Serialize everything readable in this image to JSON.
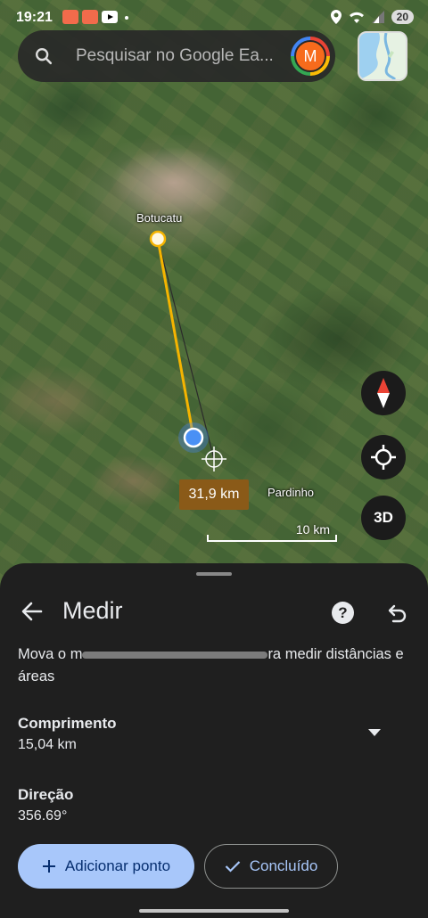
{
  "status": {
    "time": "19:21",
    "battery": "20"
  },
  "search": {
    "placeholder": "Pesquisar no Google Ea...",
    "avatar_letter": "M"
  },
  "map": {
    "labels": {
      "city_1": "Botucatu",
      "city_2": "Pardinho"
    },
    "distance_label": "31,9 km",
    "scale_label": "10 km",
    "btn_3d": "3D"
  },
  "panel": {
    "title": "Medir",
    "help": "?",
    "instructions_start": "Mova o m",
    "instructions_end": "ra medir distâncias e áreas",
    "length_label": "Comprimento",
    "length_value": "15,04 km",
    "direction_label": "Direção",
    "direction_value": "356.69°",
    "add_point_button": "Adicionar ponto",
    "done_button": "Concluído"
  },
  "colors": {
    "primary_button": "#a8c7fa",
    "measure_line": "#f5b400",
    "current_location": "#4285f4",
    "distance_label_bg": "#8a5a18"
  }
}
